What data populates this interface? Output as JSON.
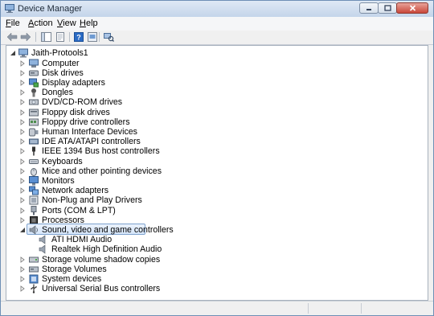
{
  "window": {
    "title": "Device Manager",
    "accent": "#c4d5ea",
    "controls": [
      "minimize-icon",
      "maximize-icon",
      "close-icon"
    ]
  },
  "menu": [
    "File",
    "Action",
    "View",
    "Help"
  ],
  "toolbar": {
    "icons": [
      "back-arrow-icon",
      "forward-arrow-icon",
      "properties-icon",
      "show-hide-tree-icon",
      "help-icon",
      "update-driver-icon",
      "scan-hardware-icon"
    ]
  },
  "tree": {
    "root": "Jaith-Protools1",
    "items": [
      {
        "label": "Computer",
        "icon": "computer-icon",
        "expanded": false
      },
      {
        "label": "Disk drives",
        "icon": "disk-drive-icon",
        "expanded": false
      },
      {
        "label": "Display adapters",
        "icon": "display-adapter-icon",
        "expanded": false
      },
      {
        "label": "Dongles",
        "icon": "dongle-icon",
        "expanded": false
      },
      {
        "label": "DVD/CD-ROM drives",
        "icon": "dvd-drive-icon",
        "expanded": false
      },
      {
        "label": "Floppy disk drives",
        "icon": "floppy-disk-icon",
        "expanded": false
      },
      {
        "label": "Floppy drive controllers",
        "icon": "floppy-controller-icon",
        "expanded": false
      },
      {
        "label": "Human Interface Devices",
        "icon": "hid-icon",
        "expanded": false
      },
      {
        "label": "IDE ATA/ATAPI controllers",
        "icon": "ide-controller-icon",
        "expanded": false
      },
      {
        "label": "IEEE 1394 Bus host controllers",
        "icon": "ieee1394-icon",
        "expanded": false
      },
      {
        "label": "Keyboards",
        "icon": "keyboard-icon",
        "expanded": false
      },
      {
        "label": "Mice and other pointing devices",
        "icon": "mouse-icon",
        "expanded": false
      },
      {
        "label": "Monitors",
        "icon": "monitor-icon",
        "expanded": false
      },
      {
        "label": "Network adapters",
        "icon": "network-adapter-icon",
        "expanded": false
      },
      {
        "label": "Non-Plug and Play Drivers",
        "icon": "non-pnp-driver-icon",
        "expanded": false
      },
      {
        "label": "Ports (COM & LPT)",
        "icon": "port-icon",
        "expanded": false
      },
      {
        "label": "Processors",
        "icon": "processor-icon",
        "expanded": false
      },
      {
        "label": "Sound, video and game controllers",
        "icon": "sound-icon",
        "expanded": true,
        "selected": true,
        "children": [
          {
            "label": "ATI HDMI Audio",
            "icon": "speaker-icon"
          },
          {
            "label": "Realtek High Definition Audio",
            "icon": "speaker-icon"
          }
        ]
      },
      {
        "label": "Storage volume shadow copies",
        "icon": "storage-shadow-icon",
        "expanded": false
      },
      {
        "label": "Storage Volumes",
        "icon": "storage-volume-icon",
        "expanded": false
      },
      {
        "label": "System devices",
        "icon": "system-device-icon",
        "expanded": false
      },
      {
        "label": "Universal Serial Bus controllers",
        "icon": "usb-icon",
        "expanded": false
      }
    ]
  },
  "colors": {
    "selection": "#d6e6fa",
    "selection_border": "#7da2ce"
  }
}
